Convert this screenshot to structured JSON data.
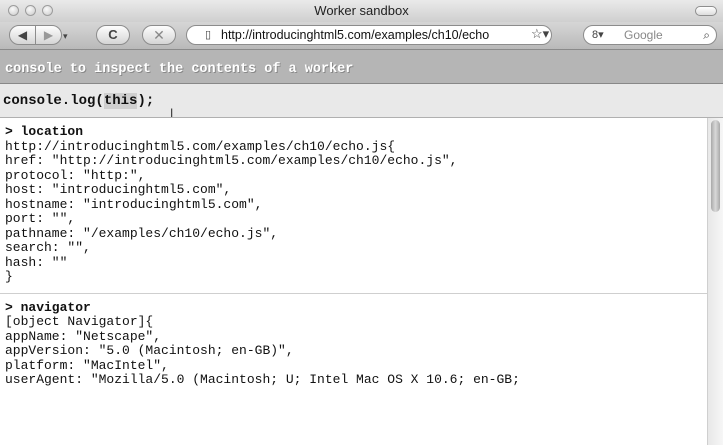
{
  "window": {
    "title": "Worker sandbox"
  },
  "toolbar": {
    "url": "http://introducinghtml5.com/examples/ch10/echo",
    "search_engine_label": "Google",
    "icons": [
      "back-icon",
      "forward-icon",
      "reload-icon",
      "stop-icon",
      "page-icon",
      "bookmark-star-icon",
      "search-engine-icon",
      "magnifier-icon"
    ]
  },
  "page": {
    "banner_text": "console to inspect the contents of a worker",
    "command": {
      "before": "console.log(",
      "highlight": "this",
      "after": ");"
    }
  },
  "console": {
    "entries": [
      {
        "head": "> location",
        "lines": [
          "http://introducinghtml5.com/examples/ch10/echo.js{",
          "href: \"http://introducinghtml5.com/examples/ch10/echo.js\",",
          "protocol: \"http:\",",
          "host: \"introducinghtml5.com\",",
          "hostname: \"introducinghtml5.com\",",
          "port: \"\",",
          "pathname: \"/examples/ch10/echo.js\",",
          "search: \"\",",
          "hash: \"\"",
          "}"
        ]
      },
      {
        "head": "> navigator",
        "lines": [
          "[object Navigator]{",
          "appName: \"Netscape\",",
          "appVersion: \"5.0 (Macintosh; en-GB)\",",
          "platform: \"MacIntel\",",
          "userAgent: \"Mozilla/5.0 (Macintosh; U; Intel Mac OS X 10.6; en-GB;"
        ]
      }
    ]
  },
  "colors": {
    "banner_bg": "#b5b5b5",
    "command_bg": "#e9e9e9"
  }
}
